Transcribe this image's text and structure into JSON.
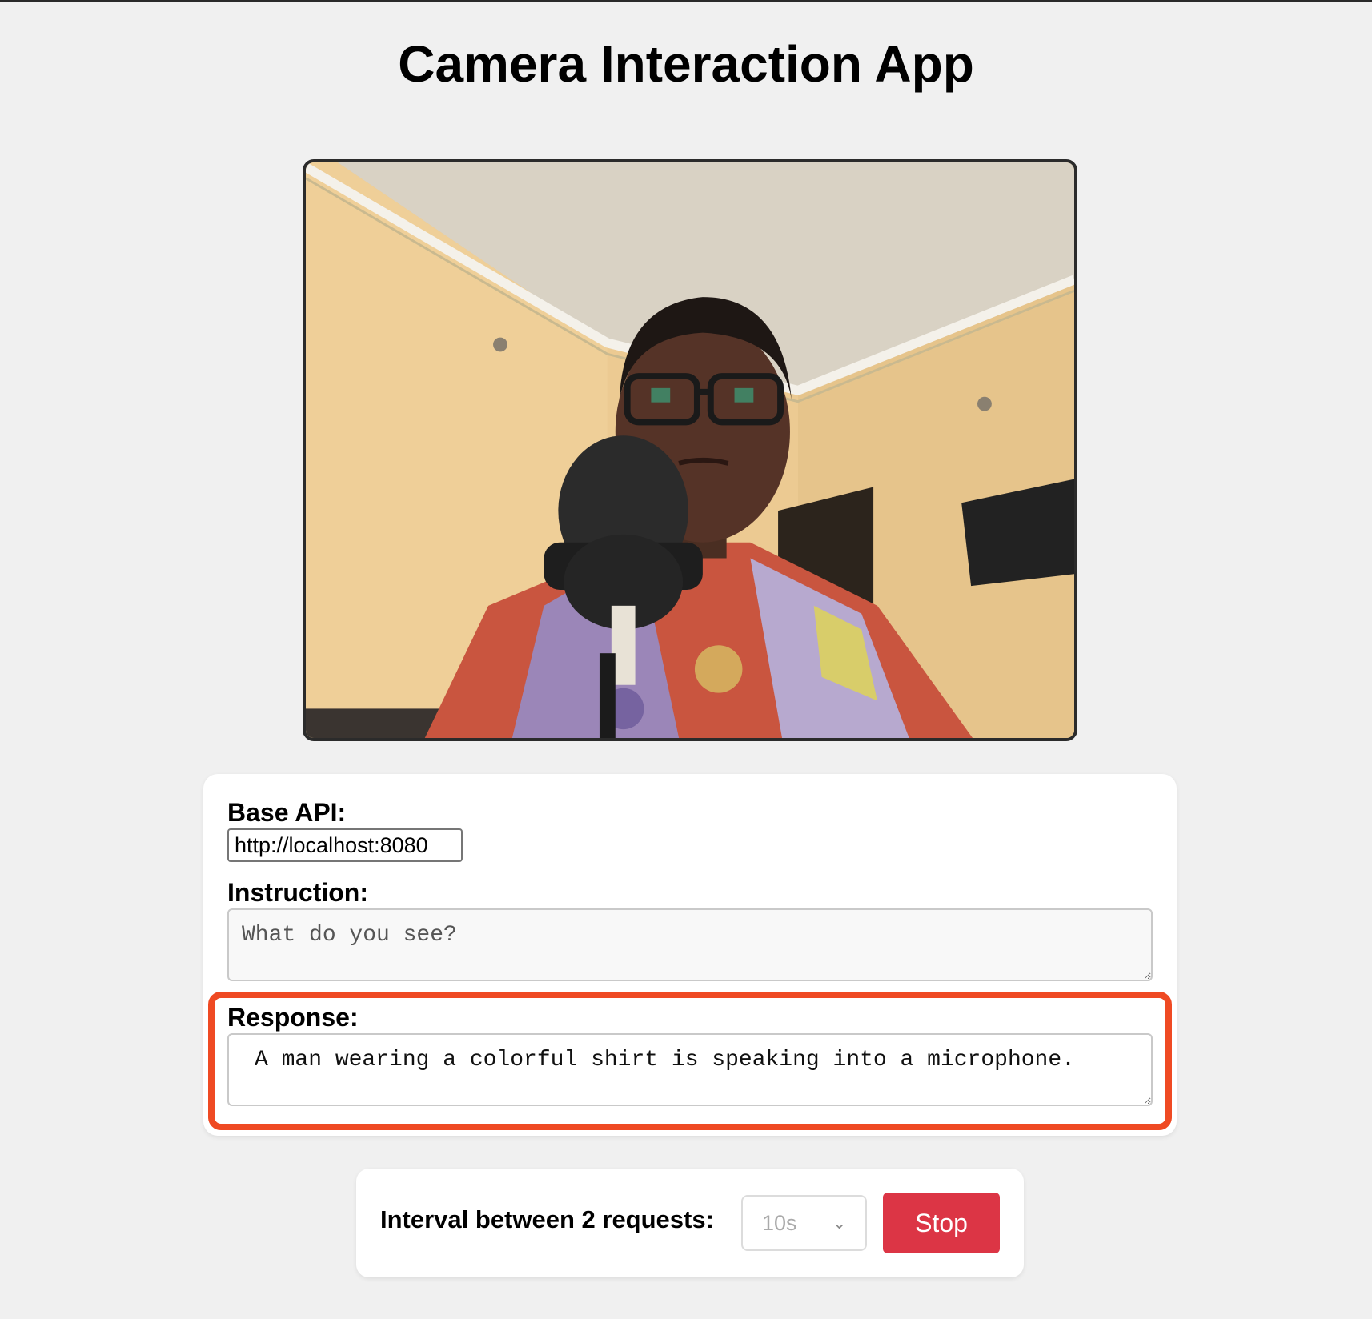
{
  "app": {
    "title": "Camera Interaction App"
  },
  "camera": {
    "description": "Live camera feed showing a person speaking into a microphone"
  },
  "form": {
    "base_api_label": "Base API:",
    "base_api_value": "http://localhost:8080",
    "instruction_label": "Instruction:",
    "instruction_value": "What do you see?",
    "response_label": "Response:",
    "response_value": "A man wearing a colorful shirt is speaking into a microphone."
  },
  "interval": {
    "label": "Interval between 2 requests:",
    "selected": "10s",
    "stop_label": "Stop"
  },
  "colors": {
    "highlight": "#ef4a23",
    "stop_button": "#dc3545",
    "background": "#f0f0f0"
  }
}
